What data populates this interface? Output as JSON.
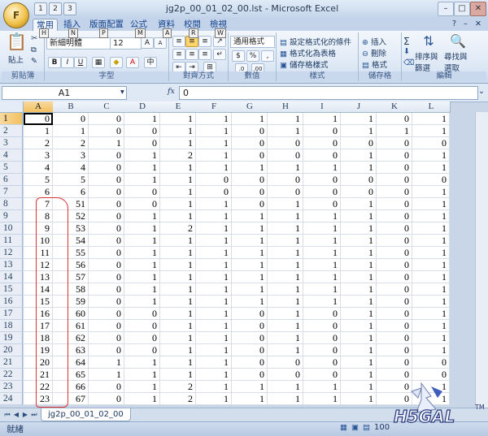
{
  "window": {
    "title": "jg2p_00_01_02_00.lst - Microsoft Excel",
    "office_button": "F",
    "qat": [
      "1",
      "2",
      "3"
    ],
    "controls": [
      "–",
      "□",
      "✕"
    ],
    "ribbon_controls": [
      "?",
      "–",
      "✕"
    ]
  },
  "tabs": [
    {
      "label": "常用",
      "key": "H",
      "active": true
    },
    {
      "label": "插入",
      "key": "N"
    },
    {
      "label": "版面配置",
      "key": "P"
    },
    {
      "label": "公式",
      "key": "M"
    },
    {
      "label": "資料",
      "key": "A"
    },
    {
      "label": "校閱",
      "key": "R"
    },
    {
      "label": "檢視",
      "key": "W"
    }
  ],
  "ribbon": {
    "clipboard": {
      "label": "剪貼簿",
      "paste": "貼上"
    },
    "font": {
      "label": "字型",
      "name": "新細明體",
      "size": "12",
      "bold": "B",
      "italic": "I",
      "underline": "U",
      "grow": "A",
      "shrink": "A"
    },
    "alignment": {
      "label": "對齊方式"
    },
    "number": {
      "label": "數值",
      "format": "通用格式",
      "currency": "$",
      "percent": "%",
      "comma": ","
    },
    "styles": {
      "label": "樣式",
      "cond": "設定格式化的條件",
      "table": "格式化為表格",
      "cell": "儲存格樣式"
    },
    "cells": {
      "label": "儲存格",
      "insert": "插入",
      "delete": "刪除",
      "format": "格式"
    },
    "editing": {
      "label": "編輯",
      "sigma": "Σ",
      "sort_line1": "排序與",
      "sort_line2": "篩選",
      "find_line1": "尋找與",
      "find_line2": "選取"
    }
  },
  "formula_bar": {
    "name_box": "A1",
    "fx": "fx",
    "value": "0"
  },
  "sheet": {
    "columns": [
      "A",
      "B",
      "C",
      "D",
      "E",
      "F",
      "G",
      "H",
      "I",
      "J",
      "K",
      "L"
    ],
    "row_numbers": [
      "1",
      "2",
      "3",
      "4",
      "5",
      "6",
      "7",
      "8",
      "9",
      "10",
      "11",
      "12",
      "13",
      "14",
      "15",
      "16",
      "17",
      "18",
      "19",
      "20",
      "21",
      "22",
      "23",
      "24"
    ],
    "rows": [
      [
        "0",
        "0",
        "0",
        "1",
        "1",
        "1",
        "1",
        "1",
        "1",
        "1",
        "0",
        "1"
      ],
      [
        "1",
        "1",
        "0",
        "0",
        "1",
        "1",
        "0",
        "1",
        "0",
        "1",
        "1",
        "1"
      ],
      [
        "2",
        "2",
        "1",
        "0",
        "1",
        "1",
        "0",
        "0",
        "0",
        "0",
        "0",
        "0"
      ],
      [
        "3",
        "3",
        "0",
        "1",
        "2",
        "1",
        "0",
        "0",
        "0",
        "1",
        "0",
        "1"
      ],
      [
        "4",
        "4",
        "0",
        "1",
        "1",
        "1",
        "1",
        "1",
        "1",
        "1",
        "0",
        "1"
      ],
      [
        "5",
        "5",
        "0",
        "1",
        "1",
        "0",
        "0",
        "0",
        "0",
        "0",
        "0",
        "0"
      ],
      [
        "6",
        "6",
        "0",
        "0",
        "1",
        "0",
        "0",
        "0",
        "0",
        "0",
        "0",
        "1"
      ],
      [
        "7",
        "51",
        "0",
        "0",
        "1",
        "1",
        "0",
        "1",
        "0",
        "1",
        "0",
        "1"
      ],
      [
        "8",
        "52",
        "0",
        "1",
        "1",
        "1",
        "1",
        "1",
        "1",
        "1",
        "0",
        "1"
      ],
      [
        "9",
        "53",
        "0",
        "1",
        "2",
        "1",
        "1",
        "1",
        "1",
        "1",
        "0",
        "1"
      ],
      [
        "10",
        "54",
        "0",
        "1",
        "1",
        "1",
        "1",
        "1",
        "1",
        "1",
        "0",
        "1"
      ],
      [
        "11",
        "55",
        "0",
        "1",
        "1",
        "1",
        "1",
        "1",
        "1",
        "1",
        "0",
        "1"
      ],
      [
        "12",
        "56",
        "0",
        "1",
        "1",
        "1",
        "1",
        "1",
        "1",
        "1",
        "0",
        "1"
      ],
      [
        "13",
        "57",
        "0",
        "1",
        "1",
        "1",
        "1",
        "1",
        "1",
        "1",
        "0",
        "1"
      ],
      [
        "14",
        "58",
        "0",
        "1",
        "1",
        "1",
        "1",
        "1",
        "1",
        "1",
        "0",
        "1"
      ],
      [
        "15",
        "59",
        "0",
        "1",
        "1",
        "1",
        "1",
        "1",
        "1",
        "1",
        "0",
        "1"
      ],
      [
        "16",
        "60",
        "0",
        "0",
        "1",
        "1",
        "0",
        "1",
        "0",
        "1",
        "0",
        "1"
      ],
      [
        "17",
        "61",
        "0",
        "0",
        "1",
        "1",
        "0",
        "1",
        "0",
        "1",
        "0",
        "1"
      ],
      [
        "18",
        "62",
        "0",
        "0",
        "1",
        "1",
        "0",
        "1",
        "0",
        "1",
        "0",
        "1"
      ],
      [
        "19",
        "63",
        "0",
        "0",
        "1",
        "1",
        "0",
        "1",
        "0",
        "1",
        "0",
        "1"
      ],
      [
        "20",
        "64",
        "1",
        "1",
        "1",
        "1",
        "0",
        "0",
        "0",
        "1",
        "0",
        "0"
      ],
      [
        "21",
        "65",
        "1",
        "1",
        "1",
        "1",
        "0",
        "0",
        "0",
        "1",
        "0",
        "0"
      ],
      [
        "22",
        "66",
        "0",
        "1",
        "2",
        "1",
        "1",
        "1",
        "1",
        "1",
        "0",
        "1"
      ],
      [
        "23",
        "67",
        "0",
        "1",
        "2",
        "1",
        "1",
        "1",
        "1",
        "1",
        "0",
        "1"
      ]
    ],
    "tab_name": "jg2p_00_01_02_00"
  },
  "status": {
    "text": "就緒",
    "zoom": "100"
  },
  "watermark": {
    "text": "H5GAL",
    "mark": "TM"
  },
  "colors": {
    "annotation": "#dd3333",
    "selected_header": "#f1c15f"
  }
}
